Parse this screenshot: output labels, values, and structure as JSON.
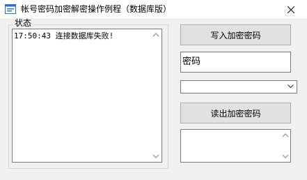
{
  "window": {
    "title": "帐号密码加密解密操作例程（数据库版）",
    "close_glyph": "×"
  },
  "status_group": {
    "label": "状态",
    "log_lines": [
      "17:50:43 连接数据库失败!"
    ]
  },
  "controls": {
    "write_button_label": "写入加密密码",
    "password_input_value": "密码",
    "dropdown_selected": "",
    "read_button_label": "读出加密密码",
    "output_value": ""
  },
  "icons": {
    "app": "app-window-icon",
    "close": "close-icon",
    "scroll_up": "chevron-up-icon",
    "scroll_down": "chevron-down-icon",
    "dropdown": "chevron-down-icon"
  },
  "colors": {
    "window_bg": "#f0f0f0",
    "titlebar_bg": "#ffffff",
    "button_bg": "#e1e1e1",
    "button_border": "#adadad",
    "field_border": "#7a7a7a",
    "app_icon_blue": "#2b6fd6"
  }
}
